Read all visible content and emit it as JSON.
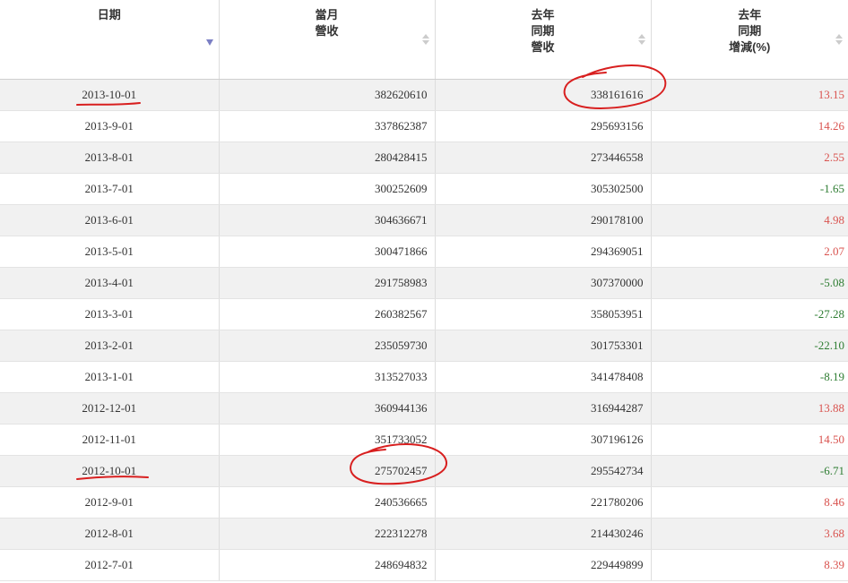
{
  "headers": {
    "date": [
      "日期"
    ],
    "revenue": [
      "當月",
      "營收"
    ],
    "last_year_revenue": [
      "去年",
      "同期",
      "營收"
    ],
    "change": [
      "去年",
      "同期",
      "增減(%)"
    ]
  },
  "rows": [
    {
      "date": "2013-10-01",
      "revenue": "382620610",
      "last_year": "338161616",
      "change": "13.15",
      "trend": "up"
    },
    {
      "date": "2013-9-01",
      "revenue": "337862387",
      "last_year": "295693156",
      "change": "14.26",
      "trend": "up"
    },
    {
      "date": "2013-8-01",
      "revenue": "280428415",
      "last_year": "273446558",
      "change": "2.55",
      "trend": "up"
    },
    {
      "date": "2013-7-01",
      "revenue": "300252609",
      "last_year": "305302500",
      "change": "-1.65",
      "trend": "down"
    },
    {
      "date": "2013-6-01",
      "revenue": "304636671",
      "last_year": "290178100",
      "change": "4.98",
      "trend": "up"
    },
    {
      "date": "2013-5-01",
      "revenue": "300471866",
      "last_year": "294369051",
      "change": "2.07",
      "trend": "up"
    },
    {
      "date": "2013-4-01",
      "revenue": "291758983",
      "last_year": "307370000",
      "change": "-5.08",
      "trend": "down"
    },
    {
      "date": "2013-3-01",
      "revenue": "260382567",
      "last_year": "358053951",
      "change": "-27.28",
      "trend": "down"
    },
    {
      "date": "2013-2-01",
      "revenue": "235059730",
      "last_year": "301753301",
      "change": "-22.10",
      "trend": "down"
    },
    {
      "date": "2013-1-01",
      "revenue": "313527033",
      "last_year": "341478408",
      "change": "-8.19",
      "trend": "down"
    },
    {
      "date": "2012-12-01",
      "revenue": "360944136",
      "last_year": "316944287",
      "change": "13.88",
      "trend": "up"
    },
    {
      "date": "2012-11-01",
      "revenue": "351733052",
      "last_year": "307196126",
      "change": "14.50",
      "trend": "up"
    },
    {
      "date": "2012-10-01",
      "revenue": "275702457",
      "last_year": "295542734",
      "change": "-6.71",
      "trend": "down"
    },
    {
      "date": "2012-9-01",
      "revenue": "240536665",
      "last_year": "221780206",
      "change": "8.46",
      "trend": "up"
    },
    {
      "date": "2012-8-01",
      "revenue": "222312278",
      "last_year": "214430246",
      "change": "3.68",
      "trend": "up"
    },
    {
      "date": "2012-7-01",
      "revenue": "248694832",
      "last_year": "229449899",
      "change": "8.39",
      "trend": "up"
    }
  ],
  "colors": {
    "positive": "#d9534f",
    "negative": "#2e7d32",
    "annotation": "#d81f1f",
    "sort_active": "#7b7fc4",
    "stripe": "#f1f1f1"
  },
  "icons": {
    "sort_active": "sort-descending-icon",
    "sort_inactive": "sort-both-icon"
  }
}
